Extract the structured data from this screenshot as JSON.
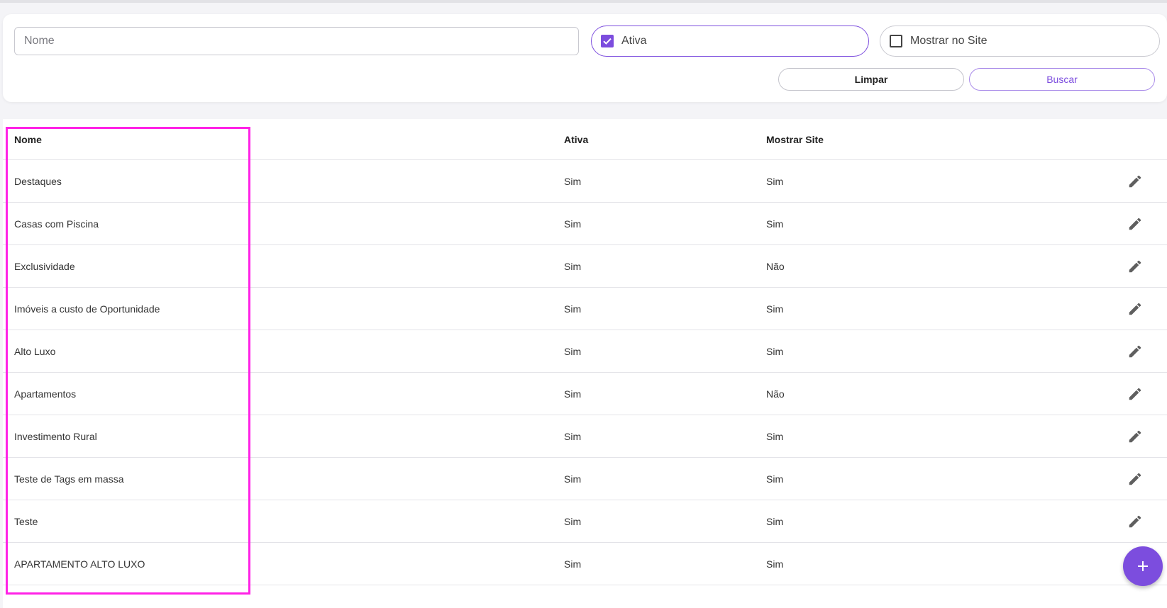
{
  "filters": {
    "name_placeholder": "Nome",
    "name_value": "",
    "ativa_label": "Ativa",
    "ativa_checked": true,
    "site_label": "Mostrar no Site",
    "site_checked": false,
    "clear_label": "Limpar",
    "search_label": "Buscar"
  },
  "table": {
    "headers": {
      "nome": "Nome",
      "ativa": "Ativa",
      "site": "Mostrar Site"
    },
    "rows": [
      {
        "nome": "Destaques",
        "ativa": "Sim",
        "site": "Sim"
      },
      {
        "nome": "Casas com Piscina",
        "ativa": "Sim",
        "site": "Sim"
      },
      {
        "nome": "Exclusividade",
        "ativa": "Sim",
        "site": "Não"
      },
      {
        "nome": "Imóveis a custo de Oportunidade",
        "ativa": "Sim",
        "site": "Sim"
      },
      {
        "nome": "Alto Luxo",
        "ativa": "Sim",
        "site": "Sim"
      },
      {
        "nome": "Apartamentos",
        "ativa": "Sim",
        "site": "Não"
      },
      {
        "nome": "Investimento Rural",
        "ativa": "Sim",
        "site": "Sim"
      },
      {
        "nome": "Teste de Tags em massa",
        "ativa": "Sim",
        "site": "Sim"
      },
      {
        "nome": "Teste",
        "ativa": "Sim",
        "site": "Sim"
      },
      {
        "nome": "APARTAMENTO ALTO LUXO",
        "ativa": "Sim",
        "site": "Sim"
      }
    ]
  },
  "icons": {
    "edit": "pencil-icon",
    "add": "plus-icon",
    "check": "check-icon"
  },
  "colors": {
    "accent": "#7c4dde",
    "highlight": "#ff22e6"
  }
}
